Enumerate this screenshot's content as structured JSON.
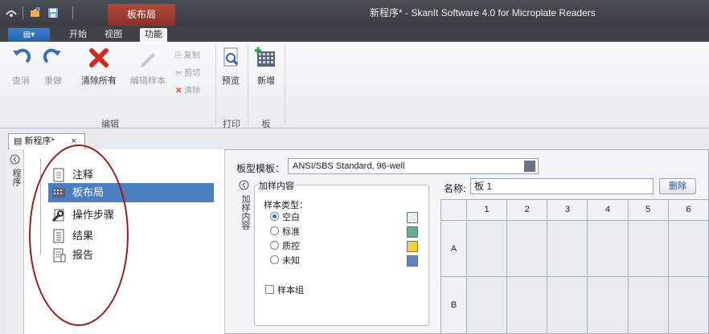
{
  "window": {
    "title": "新程序* - SkanIt Software 4.0 for Microplate Readers"
  },
  "context_tab": {
    "label": "板布局"
  },
  "ribbon_tabs": {
    "file_label": "▤▾",
    "tabs": [
      {
        "label": "开始"
      },
      {
        "label": "视图"
      },
      {
        "label": "功能"
      }
    ]
  },
  "ribbon": {
    "undo": "查消",
    "redo": "重做",
    "clear_all": "清除所有",
    "edit_sample": "编辑样本",
    "copy": "复制",
    "cut": "剪切",
    "clear": "清除",
    "preview": "预览",
    "new": "新增",
    "groups": {
      "edit": "编辑",
      "print": "打印",
      "plate": "板"
    }
  },
  "doc_tab": {
    "label": "新程序*",
    "close": "×"
  },
  "vertical_tab": {
    "label": "程序"
  },
  "tree": {
    "items": [
      {
        "label": "注释",
        "icon": "document-icon"
      },
      {
        "label": "板布局",
        "icon": "grid-icon"
      },
      {
        "label": "操作步骤",
        "icon": "wrench-icon"
      },
      {
        "label": "结果",
        "icon": "list-icon"
      },
      {
        "label": "报告",
        "icon": "report-icon"
      }
    ]
  },
  "plate": {
    "template_label": "板型模板：",
    "template_value": "ANSI/SBS Standard, 96-well",
    "add_panel_tab": "加样内容",
    "add_panel_title": "加样内容",
    "sample_type_label": "样本类型：",
    "sample_types": [
      {
        "label": "空白",
        "color": "#e8f1f3",
        "selected": true
      },
      {
        "label": "标准",
        "color": "#5fb08e",
        "selected": false
      },
      {
        "label": "质控",
        "color": "#f2d23a",
        "selected": false
      },
      {
        "label": "未知",
        "color": "#5b85c4",
        "selected": false
      }
    ],
    "sample_group_label": "样本组",
    "name_label": "名称:",
    "name_value": "板 1",
    "delete_label": "删除",
    "columns": [
      "1",
      "2",
      "3",
      "4",
      "5",
      "6"
    ],
    "rows": [
      "A",
      "B"
    ]
  }
}
